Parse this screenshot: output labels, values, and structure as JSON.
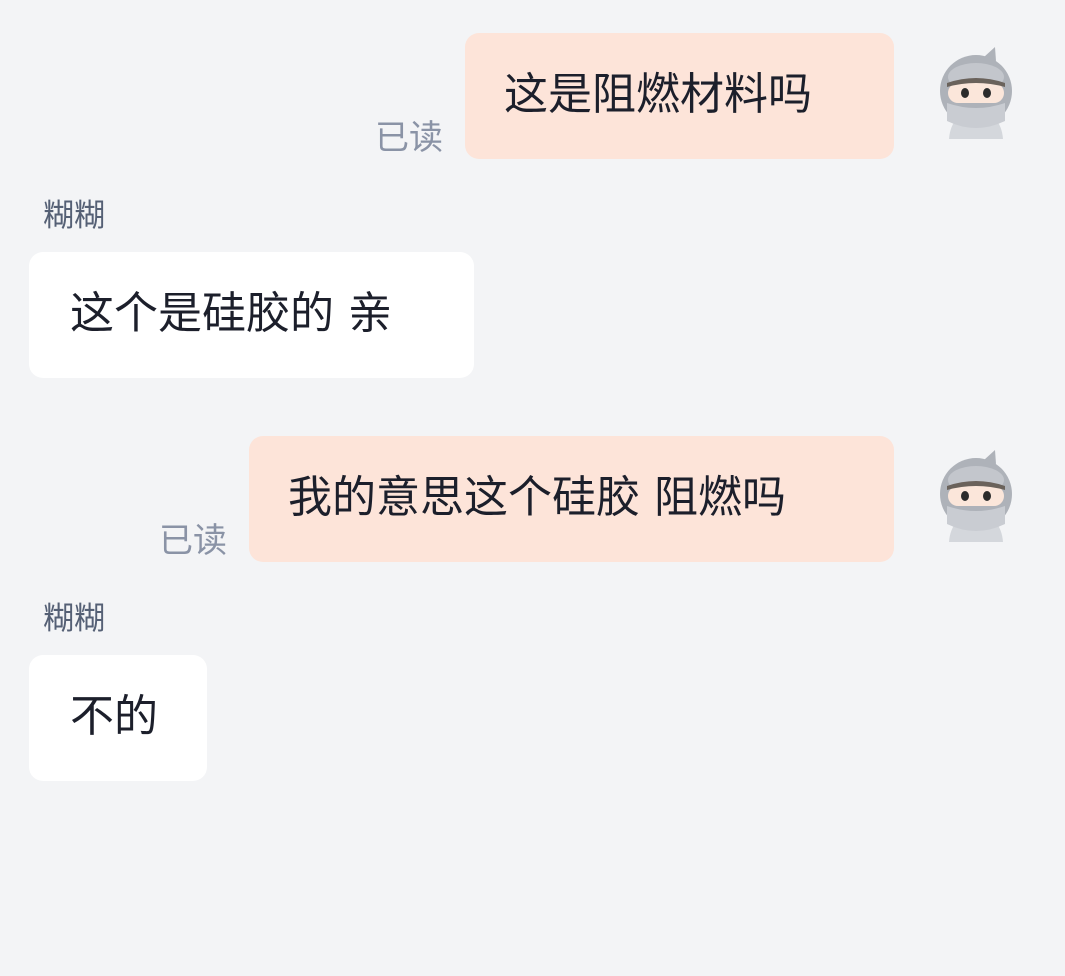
{
  "conversation": {
    "messages": [
      {
        "direction": "outgoing",
        "text": "这是阻燃材料吗",
        "status": "已读"
      },
      {
        "direction": "incoming",
        "sender": "糊糊",
        "text": "这个是硅胶的 亲"
      },
      {
        "direction": "outgoing",
        "text": "我的意思这个硅胶 阻燃吗",
        "status": "已读"
      },
      {
        "direction": "incoming",
        "sender": "糊糊",
        "text": "不的"
      }
    ]
  },
  "avatar_icon": "ninja-avatar-icon",
  "colors": {
    "background": "#f3f4f6",
    "outgoing_bubble": "#fde4d9",
    "incoming_bubble": "#ffffff",
    "read_status": "#8a93a6",
    "sender_name": "#556075",
    "message_text": "#1c1f2b"
  }
}
